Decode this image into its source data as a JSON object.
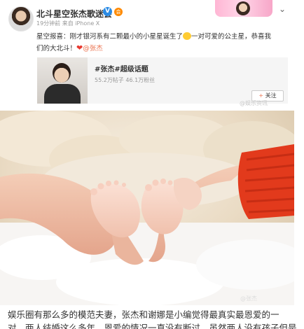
{
  "post": {
    "user_name": "北斗星空张杰歌迷会",
    "verified_glyph": "V",
    "vip_glyph": "会",
    "meta": "19分钟前 来自 iPhone X",
    "text_main": "星空报喜：刚才银河系有二颗最小的小星星诞生了",
    "text_cont": "一对可爱的公主星，恭喜我",
    "text_line2": "们的大北斗！",
    "mention": "@张杰"
  },
  "topic_card": {
    "title": "#张杰#超级话题",
    "stats": "55.2万帖子  46.1万粉丝",
    "follow_plus": "+",
    "follow_label": "关注"
  },
  "watermarks": {
    "card": "@娱乐资讯",
    "photo": "@张杰"
  },
  "caption": {
    "line1": "娱乐圈有那么多的模范夫妻，张杰和谢娜是小编觉得最真实最恩爱的一",
    "line2": "对，两人结婚这么多年，恩爱的情况一直没有断过，虽然两人没有孩子但是"
  },
  "icons": {
    "verified": "verified-icon",
    "vip": "vip-icon",
    "chevron": "chevron-down-icon",
    "heart": "heart-icon",
    "emoji": "emoji-icon"
  },
  "colors": {
    "mention": "#eb7350",
    "verified": "#2b8be4",
    "heart": "#e8382f",
    "sweater": "#e23a1c"
  }
}
